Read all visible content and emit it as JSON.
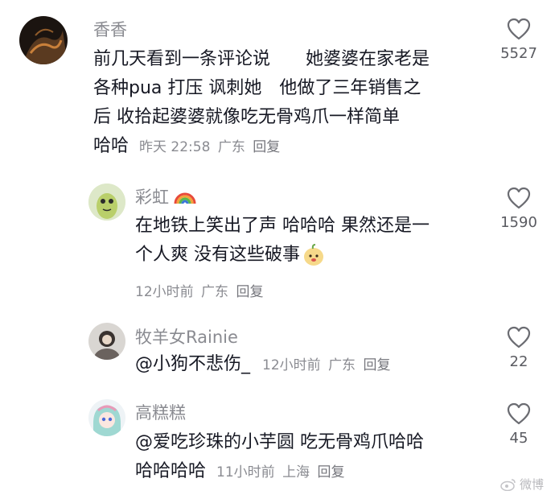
{
  "comments": [
    {
      "username": "香香",
      "lines": [
        "前几天看到一条评论说　　她婆婆在家老是",
        "各种pua 打压  讽刺她　他做了三年销售之",
        "后  收拾起婆婆就像吃无骨鸡爪一样简单"
      ],
      "last_text": "哈哈",
      "time": "昨天 22:58",
      "location": "广东",
      "reply": "回复",
      "likes": "5527"
    },
    {
      "username": "彩虹",
      "lines": [
        "在地铁上笑出了声  哈哈哈  果然还是一",
        "个人爽  没有这些破事"
      ],
      "time": "12小时前",
      "location": "广东",
      "reply": "回复",
      "likes": "1590"
    },
    {
      "username": "牧羊女Rainie",
      "text": "@小狗不悲伤_",
      "time": "12小时前",
      "location": "广东",
      "reply": "回复",
      "likes": "22"
    },
    {
      "username": "高糕糕",
      "line1": "@爱吃珍珠的小芋圆  吃无骨鸡爪哈哈",
      "last_text": "哈哈哈哈",
      "time": "11小时前",
      "location": "上海",
      "reply": "回复",
      "likes": "45"
    }
  ],
  "watermark": "微博"
}
